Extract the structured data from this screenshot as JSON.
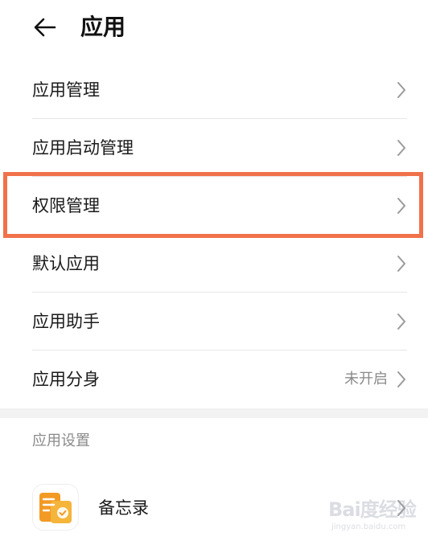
{
  "header": {
    "title": "应用"
  },
  "menu": [
    {
      "label": "应用管理"
    },
    {
      "label": "应用启动管理"
    },
    {
      "label": "权限管理"
    },
    {
      "label": "默认应用"
    },
    {
      "label": "应用助手"
    },
    {
      "label": "应用分身",
      "value": "未开启"
    }
  ],
  "section": {
    "title": "应用设置"
  },
  "apps": [
    {
      "label": "备忘录",
      "icon": "memo-app-icon"
    }
  ],
  "watermark": {
    "main": "Bai度经验",
    "sub": "jingyan.baidu.com"
  },
  "colors": {
    "highlight": "#f0714a",
    "memo_orange": "#f39a24",
    "memo_yellow": "#f5b43a"
  }
}
